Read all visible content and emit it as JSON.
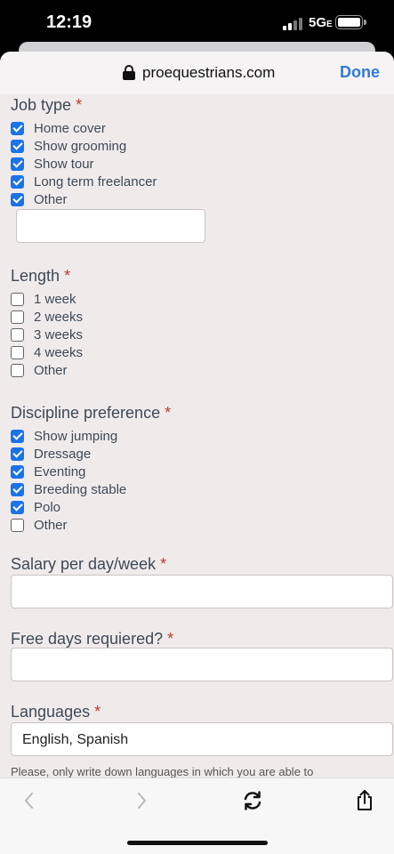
{
  "status": {
    "time": "12:19",
    "network": "5G",
    "network_suffix": "E"
  },
  "browser": {
    "url": "proequestrians.com",
    "done_label": "Done"
  },
  "form": {
    "job_type": {
      "label": "Job type",
      "required": "*",
      "options": [
        {
          "label": "Home cover",
          "checked": true
        },
        {
          "label": "Show grooming",
          "checked": true
        },
        {
          "label": "Show tour",
          "checked": true
        },
        {
          "label": "Long term freelancer",
          "checked": true
        },
        {
          "label": "Other",
          "checked": true
        }
      ],
      "other_value": ""
    },
    "length": {
      "label": "Length",
      "required": "*",
      "options": [
        {
          "label": "1 week",
          "checked": false
        },
        {
          "label": "2 weeks",
          "checked": false
        },
        {
          "label": "3 weeks",
          "checked": false
        },
        {
          "label": "4 weeks",
          "checked": false
        },
        {
          "label": "Other",
          "checked": false
        }
      ]
    },
    "discipline": {
      "label": "Discipline preference",
      "required": "*",
      "options": [
        {
          "label": "Show jumping",
          "checked": true
        },
        {
          "label": "Dressage",
          "checked": true
        },
        {
          "label": "Eventing",
          "checked": true
        },
        {
          "label": "Breeding stable",
          "checked": true
        },
        {
          "label": "Polo",
          "checked": true
        },
        {
          "label": "Other",
          "checked": false
        }
      ]
    },
    "salary": {
      "label": "Salary per day/week",
      "required": "*",
      "value": ""
    },
    "free_days": {
      "label": "Free days requiered?",
      "required": "*",
      "value": ""
    },
    "languages": {
      "label": "Languages",
      "required": "*",
      "value": "English, Spanish",
      "helper": "Please, only write down languages in which you are able to"
    }
  },
  "toolbar": {
    "back_icon": "chevron-left-icon",
    "forward_icon": "chevron-right-icon",
    "reload_icon": "reload-icon",
    "share_icon": "share-icon"
  }
}
